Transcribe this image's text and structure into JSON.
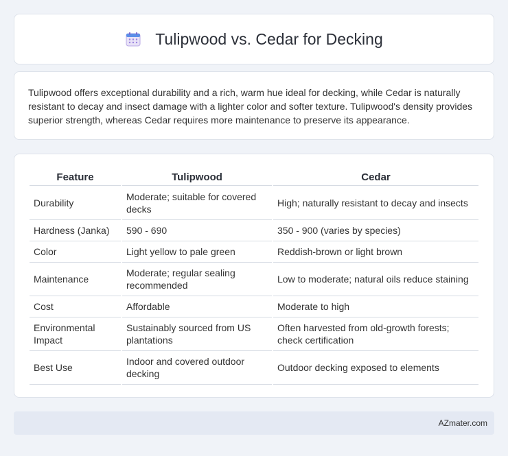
{
  "header": {
    "title": "Tulipwood vs. Cedar for Decking",
    "icon": "calendar-icon"
  },
  "intro": {
    "text": "Tulipwood offers exceptional durability and a rich, warm hue ideal for decking, while Cedar is naturally resistant to decay and insect damage with a lighter color and softer texture. Tulipwood's density provides superior strength, whereas Cedar requires more maintenance to preserve its appearance."
  },
  "table": {
    "headers": [
      "Feature",
      "Tulipwood",
      "Cedar"
    ],
    "rows": [
      [
        "Durability",
        "Moderate; suitable for covered decks",
        "High; naturally resistant to decay and insects"
      ],
      [
        "Hardness (Janka)",
        "590 - 690",
        "350 - 900 (varies by species)"
      ],
      [
        "Color",
        "Light yellow to pale green",
        "Reddish-brown or light brown"
      ],
      [
        "Maintenance",
        "Moderate; regular sealing recommended",
        "Low to moderate; natural oils reduce staining"
      ],
      [
        "Cost",
        "Affordable",
        "Moderate to high"
      ],
      [
        "Environmental Impact",
        "Sustainably sourced from US plantations",
        "Often harvested from old-growth forests; check certification"
      ],
      [
        "Best Use",
        "Indoor and covered outdoor decking",
        "Outdoor decking exposed to elements"
      ]
    ]
  },
  "footer": {
    "text": "AZmater.com"
  }
}
